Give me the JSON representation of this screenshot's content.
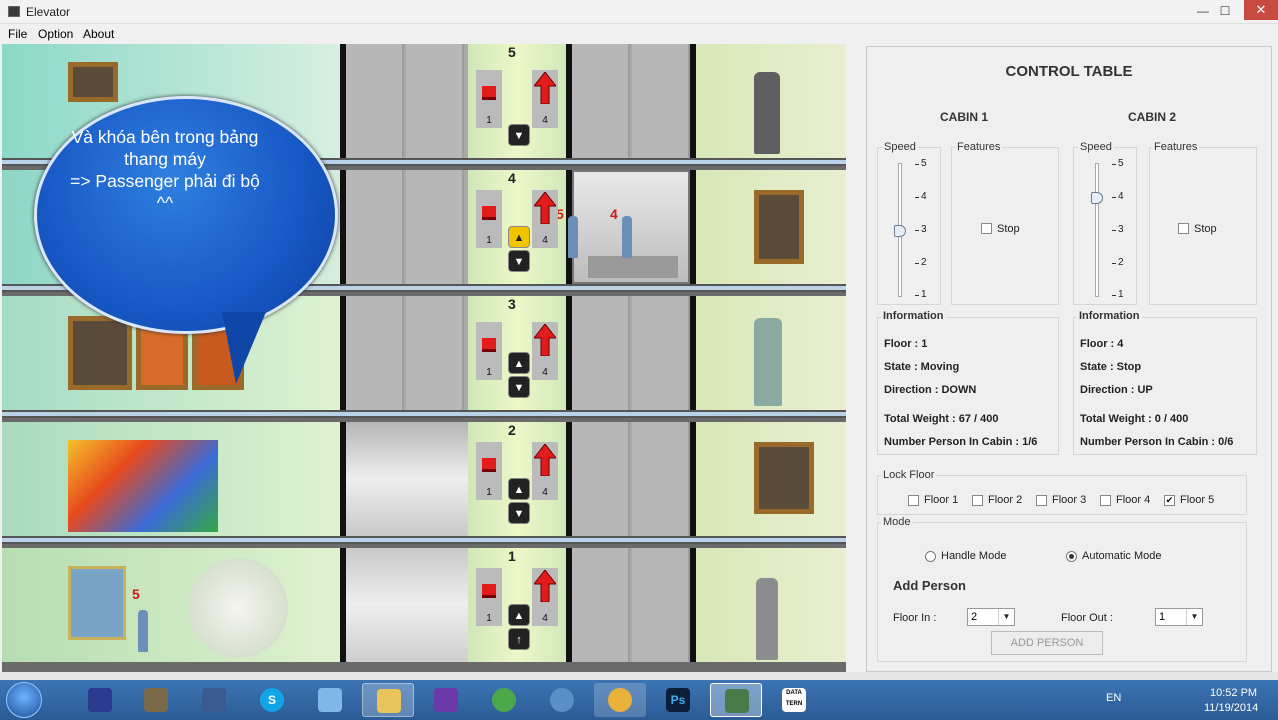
{
  "window": {
    "title": "Elevator",
    "minimize": "—",
    "maximize": "☐",
    "close": "✕"
  },
  "menu": [
    {
      "label": "File"
    },
    {
      "label": "Option"
    },
    {
      "label": "About"
    }
  ],
  "speech_bubble": {
    "line1": "Và khóa bên trong bảng",
    "line2": "thang máy",
    "line3": "=> Passenger phải đi bộ",
    "line4": "^^"
  },
  "floors": [
    {
      "number": "5",
      "cabin1_count": "1",
      "cabin2_count": "4"
    },
    {
      "number": "4",
      "cabin1_count": "1",
      "cabin2_count": "4"
    },
    {
      "number": "3",
      "cabin1_count": "1",
      "cabin2_count": "4"
    },
    {
      "number": "2",
      "cabin1_count": "1",
      "cabin2_count": "4"
    },
    {
      "number": "1",
      "cabin1_count": "1",
      "cabin2_count": "4"
    }
  ],
  "people_labels": {
    "floor4_a": "5",
    "floor4_b": "4",
    "floor1": "5"
  },
  "control_table": {
    "title": "CONTROL TABLE",
    "cabin1": {
      "title": "CABIN 1",
      "speed_label": "Speed",
      "features_label": "Features",
      "stop_label": "Stop",
      "speed_value": 3,
      "info_label": "Information",
      "floor": "Floor : 1",
      "state": "State : Moving",
      "direction": "Direction : DOWN",
      "total_weight": "Total Weight : 67 / 400",
      "persons": "Number Person In Cabin : 1/6"
    },
    "cabin2": {
      "title": "CABIN 2",
      "speed_label": "Speed",
      "features_label": "Features",
      "stop_label": "Stop",
      "speed_value": 4,
      "info_label": "Information",
      "floor": "Floor : 4",
      "state": "State : Stop",
      "direction": "Direction : UP",
      "total_weight": "Total Weight : 0 / 400",
      "persons": "Number Person In Cabin : 0/6"
    },
    "speed_ticks": [
      "5",
      "4",
      "3",
      "2",
      "1"
    ],
    "lock_floor": {
      "label": "Lock Floor",
      "options": [
        {
          "label": "Floor 1",
          "checked": false
        },
        {
          "label": "Floor 2",
          "checked": false
        },
        {
          "label": "Floor 3",
          "checked": false
        },
        {
          "label": "Floor 4",
          "checked": false
        },
        {
          "label": "Floor 5",
          "checked": true
        }
      ]
    },
    "mode": {
      "label": "Mode",
      "handle": "Handle Mode",
      "automatic": "Automatic Mode",
      "selected": "automatic"
    },
    "add_person": {
      "title": "Add Person",
      "floor_in_label": "Floor In :",
      "floor_in_value": "2",
      "floor_out_label": "Floor Out :",
      "floor_out_value": "1",
      "button": "ADD PERSON"
    }
  },
  "taskbar": {
    "apps": [
      {
        "icon": "taskbar-app-icon"
      },
      {
        "icon": "gimp-icon"
      },
      {
        "icon": "wireshark-icon"
      },
      {
        "icon": "skype-icon",
        "text": "S"
      },
      {
        "icon": "box-icon"
      },
      {
        "icon": "folder-icon"
      },
      {
        "icon": "visual-studio-icon"
      },
      {
        "icon": "app-icon"
      },
      {
        "icon": "mail-icon"
      },
      {
        "icon": "chrome-icon"
      },
      {
        "icon": "photoshop-icon",
        "text": "Ps"
      },
      {
        "icon": "elevator-app-icon"
      },
      {
        "icon": "datatern-icon",
        "text": "DATA TERN"
      }
    ],
    "lang": "EN",
    "time": "10:52 PM",
    "date": "11/19/2014"
  }
}
